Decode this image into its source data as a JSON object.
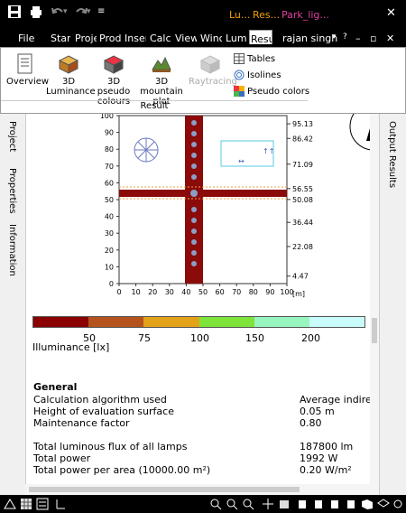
{
  "titlebar": {
    "ctx_tabs": [
      "Lu...",
      "Res...",
      "Park_lig..."
    ],
    "close": "✕"
  },
  "ribbon_tabs": [
    "File",
    "Start",
    "Proje",
    "Prodi",
    "Inser",
    "Calcu",
    "View",
    "Winc",
    "Lumi",
    "Resu"
  ],
  "user": "rajan singh",
  "ribbon": {
    "buttons": [
      "Overview",
      "3D Luminance",
      "3D pseudo colours",
      "3D mountain plot",
      "Raytracing"
    ],
    "small": [
      "Tables",
      "Isolines",
      "Pseudo colors"
    ],
    "group": "Result"
  },
  "left_tabs": [
    "Project",
    "Properties",
    "Information"
  ],
  "right_tab": "Output Results",
  "plot": {
    "x_ticks": [
      "0",
      "10",
      "20",
      "30",
      "40",
      "50",
      "60",
      "70",
      "80",
      "90",
      "100"
    ],
    "y_ticks": [
      "0",
      "10",
      "20",
      "30",
      "40",
      "50",
      "60",
      "70",
      "80",
      "90",
      "100"
    ],
    "unit": "[m]",
    "right_values": [
      "95.13",
      "86.42",
      "71.09",
      "56.55",
      "50.08",
      "36.44",
      "22.08",
      "4.47"
    ]
  },
  "legend": {
    "colors": [
      "#8b0000",
      "#b5531d",
      "#e3a21a",
      "#7fe43a",
      "#99f5c0",
      "#c9fbfb"
    ],
    "labels": [
      "50",
      "75",
      "100",
      "150",
      "200"
    ],
    "title": "Illuminance [lx]"
  },
  "report": {
    "heading": "General",
    "rows": [
      {
        "label": "Calculation algorithm used",
        "value": "Average indirect"
      },
      {
        "label": "Height of evaluation surface",
        "value": "0.05 m"
      },
      {
        "label": "Maintenance factor",
        "value": "0.80"
      }
    ],
    "rows2": [
      {
        "label": "Total luminous flux of all lamps",
        "value": "187800 lm"
      },
      {
        "label": "Total power",
        "value": "1992 W"
      },
      {
        "label": "Total power per area (10000.00 m²)",
        "value": "0.20 W/m²"
      }
    ]
  }
}
